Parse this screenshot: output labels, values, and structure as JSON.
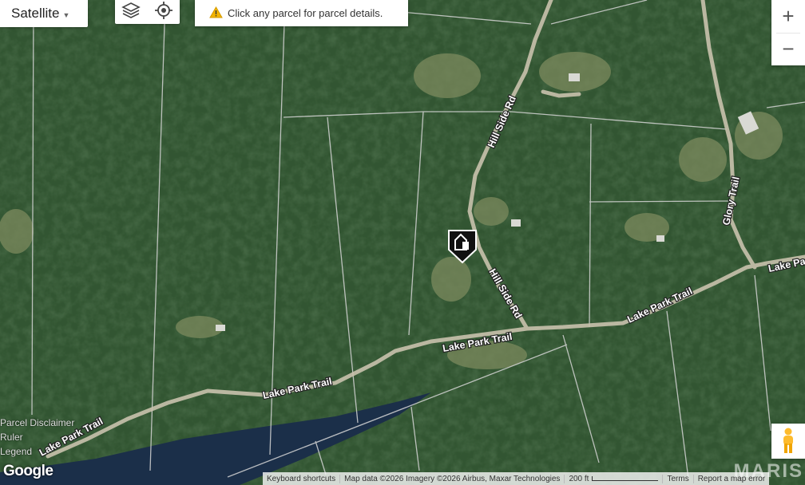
{
  "map_type": {
    "label": "Satellite"
  },
  "toolbar": {
    "layers_icon": "layers-icon",
    "locate_icon": "locate-icon"
  },
  "notice": {
    "text": "Click any parcel for parcel details."
  },
  "zoom": {
    "in": "+",
    "out": "−"
  },
  "roads": {
    "hill_side_1": "Hill Side Rd",
    "hill_side_2": "Hill Side Rd",
    "glory": "Glory Trail",
    "lake_park_1": "Lake Park Trail",
    "lake_park_2": "Lake Park Trail",
    "lake_park_3": "Lake Park Trail",
    "lake_park_4": "Lake Park Trail",
    "lake_park_5": "Lake Pa"
  },
  "left_links": {
    "disclaimer": "Parcel Disclaimer",
    "ruler": "Ruler",
    "legend": "Legend"
  },
  "attribution": {
    "shortcuts": "Keyboard shortcuts",
    "map_data": "Map data ©2026 Imagery ©2026 Airbus, Maxar Technologies",
    "scale": "200 ft",
    "terms": "Terms",
    "report": "Report a map error"
  },
  "logo": "Google",
  "watermark": "MARIS",
  "colors": {
    "forest": "#2f5230",
    "water": "#1b2f49",
    "road": "#c9c2ad"
  }
}
